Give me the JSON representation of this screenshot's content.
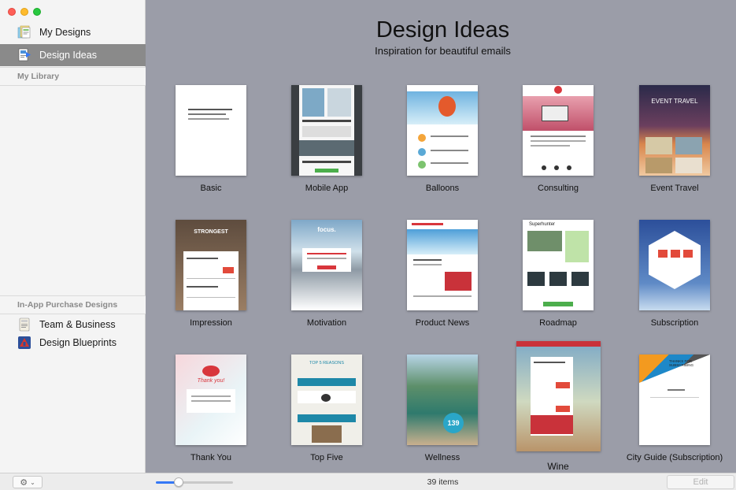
{
  "window": {
    "title": "Design Ideas",
    "subtitle": "Inspiration for beautiful emails"
  },
  "sidebar": {
    "items": [
      {
        "label": "My Designs",
        "icon": "my-designs-icon"
      },
      {
        "label": "Design Ideas",
        "icon": "design-ideas-icon",
        "selected": true
      }
    ],
    "library_section": "My Library",
    "purchase_section": "In-App Purchase Designs",
    "purchase_items": [
      {
        "label": "Team & Business",
        "icon": "team-business-icon"
      },
      {
        "label": "Design Blueprints",
        "icon": "design-blueprints-icon"
      }
    ]
  },
  "templates": [
    {
      "label": "Basic"
    },
    {
      "label": "Mobile App"
    },
    {
      "label": "Balloons"
    },
    {
      "label": "Consulting"
    },
    {
      "label": "Event Travel",
      "thumb_text": "EVENT TRAVEL"
    },
    {
      "label": "Impression",
      "thumb_text": "STRONGEST"
    },
    {
      "label": "Motivation",
      "thumb_text": "focus."
    },
    {
      "label": "Product News"
    },
    {
      "label": "Roadmap",
      "thumb_text": "Superhunter"
    },
    {
      "label": "Subscription"
    },
    {
      "label": "Thank You",
      "thumb_text": "Thank you!"
    },
    {
      "label": "Top Five",
      "thumb_text": "TOP 5 REASONS"
    },
    {
      "label": "Wellness",
      "thumb_text": "139"
    },
    {
      "label": "Wine"
    },
    {
      "label": "City Guide (Subscription)",
      "thumb_text": "THANKS FOR SUBSCRIBING"
    }
  ],
  "bottombar": {
    "items_count": "39 items",
    "edit_label": "Edit",
    "zoom_level": 0.3
  }
}
